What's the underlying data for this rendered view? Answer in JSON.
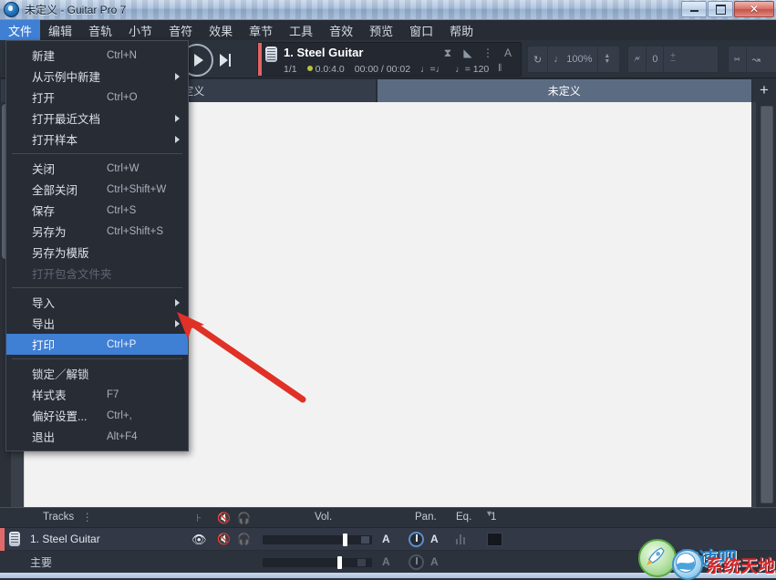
{
  "window": {
    "title": "未定义 - Guitar Pro 7",
    "icon": "guitar-pro-icon",
    "minimize_label": "",
    "maximize_label": "",
    "close_label": "✕"
  },
  "menubar": {
    "items": [
      {
        "label": "文件",
        "active": true
      },
      {
        "label": "编辑",
        "active": false
      },
      {
        "label": "音轨",
        "active": false
      },
      {
        "label": "小节",
        "active": false
      },
      {
        "label": "音符",
        "active": false
      },
      {
        "label": "效果",
        "active": false
      },
      {
        "label": "章节",
        "active": false
      },
      {
        "label": "工具",
        "active": false
      },
      {
        "label": "音效",
        "active": false
      },
      {
        "label": "预览",
        "active": false
      },
      {
        "label": "窗口",
        "active": false
      },
      {
        "label": "帮助",
        "active": false
      }
    ]
  },
  "file_menu": {
    "groups": [
      [
        {
          "label": "新建",
          "shortcut": "Ctrl+N",
          "submenu": false,
          "disabled": false,
          "selected": false
        },
        {
          "label": "从示例中新建",
          "shortcut": "",
          "submenu": true,
          "disabled": false,
          "selected": false
        },
        {
          "label": "打开",
          "shortcut": "Ctrl+O",
          "submenu": false,
          "disabled": false,
          "selected": false
        },
        {
          "label": "打开最近文档",
          "shortcut": "",
          "submenu": true,
          "disabled": false,
          "selected": false
        },
        {
          "label": "打开样本",
          "shortcut": "",
          "submenu": true,
          "disabled": false,
          "selected": false
        }
      ],
      [
        {
          "label": "关闭",
          "shortcut": "Ctrl+W",
          "submenu": false,
          "disabled": false,
          "selected": false
        },
        {
          "label": "全部关闭",
          "shortcut": "Ctrl+Shift+W",
          "submenu": false,
          "disabled": false,
          "selected": false
        },
        {
          "label": "保存",
          "shortcut": "Ctrl+S",
          "submenu": false,
          "disabled": false,
          "selected": false
        },
        {
          "label": "另存为",
          "shortcut": "Ctrl+Shift+S",
          "submenu": false,
          "disabled": false,
          "selected": false
        },
        {
          "label": "另存为模版",
          "shortcut": "",
          "submenu": false,
          "disabled": false,
          "selected": false
        },
        {
          "label": "打开包含文件夹",
          "shortcut": "",
          "submenu": false,
          "disabled": true,
          "selected": false
        }
      ],
      [
        {
          "label": "导入",
          "shortcut": "",
          "submenu": true,
          "disabled": false,
          "selected": false
        },
        {
          "label": "导出",
          "shortcut": "",
          "submenu": true,
          "disabled": false,
          "selected": false
        },
        {
          "label": "打印",
          "shortcut": "Ctrl+P",
          "submenu": false,
          "disabled": false,
          "selected": true
        }
      ],
      [
        {
          "label": "锁定／解锁",
          "shortcut": "",
          "submenu": false,
          "disabled": false,
          "selected": false
        },
        {
          "label": "样式表",
          "shortcut": "F7",
          "submenu": false,
          "disabled": false,
          "selected": false
        },
        {
          "label": "偏好设置...",
          "shortcut": "Ctrl+,",
          "submenu": false,
          "disabled": false,
          "selected": false
        },
        {
          "label": "退出",
          "shortcut": "Alt+F4",
          "submenu": false,
          "disabled": false,
          "selected": false
        }
      ]
    ]
  },
  "toolbar": {
    "play_label": "",
    "next_label": "",
    "track": {
      "name": "1. Steel Guitar",
      "measure": "1/1",
      "position": "0.0:4.0",
      "time": "00:00 / 00:02",
      "signature": "♩=♩",
      "tempo": "♩= 120",
      "accent_color": "#e06464"
    },
    "loop_label": "",
    "speed_value": "100%",
    "tuning_value": "0",
    "plus_minus": "±"
  },
  "tabs": {
    "items": [
      {
        "label": "未定义",
        "active": false
      },
      {
        "label": "未定义",
        "active": true
      }
    ],
    "add_label": "+"
  },
  "tracks_panel": {
    "header": {
      "title": "Tracks",
      "kebab": "⋮",
      "vol": "Vol.",
      "pan": "Pan.",
      "eq": "Eq.",
      "count": "1"
    },
    "rows": [
      {
        "name": "1. Steel Guitar",
        "visible_icon": "eye-icon",
        "automation": "A",
        "accent": "#e06a6a"
      },
      {
        "name": "主要",
        "visible_icon": "",
        "automation": "A",
        "accent": ""
      }
    ]
  },
  "watermarks": [
    {
      "text": "加速吧",
      "color": "#1f7ec4"
    },
    {
      "text": "系统天地",
      "color": "#d4262b"
    }
  ]
}
